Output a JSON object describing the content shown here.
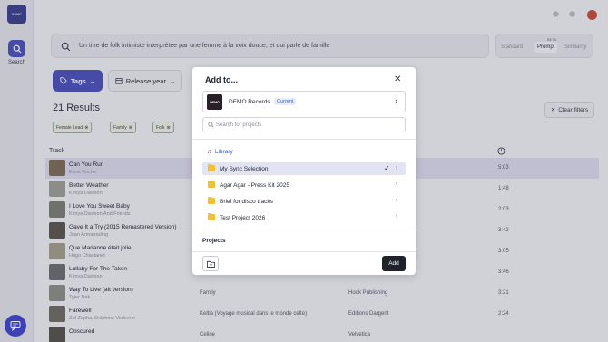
{
  "app": {
    "logo_text": "SYNC",
    "nav_search_label": "Search"
  },
  "search": {
    "query": "Un titre de folk intimiste interprétée par une femme à la voix douce, et qui parle de famille"
  },
  "modes": {
    "standard": "Standard",
    "prompt": "Prompt",
    "beta": "BETA",
    "similarity": "Similarity"
  },
  "filters": {
    "tags_label": "Tags",
    "release_label": "Release year",
    "results": "21 Results",
    "clear_label": "Clear filters",
    "chips": [
      "Female Lead",
      "Family",
      "Folk"
    ]
  },
  "table": {
    "track_header": "Track",
    "rows": [
      {
        "title": "Can You Run",
        "artist": "Ernst Koche",
        "c3": "",
        "c4": "",
        "c5": "5:03"
      },
      {
        "title": "Better Weather",
        "artist": "Kimya Dawson",
        "c3": "",
        "c4": "",
        "c5": "1:48"
      },
      {
        "title": "I Love You Sweet Baby",
        "artist": "Kimya Dawson And Friends",
        "c3": "",
        "c4": "",
        "c5": "2:03"
      },
      {
        "title": "Gave It a Try (2015 Remastered Version)",
        "artist": "Joan Armatrading",
        "c3": "",
        "c4": "",
        "c5": "3:42"
      },
      {
        "title": "Que Marianne était jolie",
        "artist": "Hugo Chastanet",
        "c3": "",
        "c4": "",
        "c5": "3:05"
      },
      {
        "title": "Lullaby For The Taken",
        "artist": "Kimya Dawson",
        "c3": "Aussin Vagenda",
        "c4": "Velvetica",
        "c5": "3:46"
      },
      {
        "title": "Way To Live (alt version)",
        "artist": "Tyler Nak",
        "c3": "Family",
        "c4": "Hook Publishing",
        "c5": "3:21"
      },
      {
        "title": "Farewell",
        "artist": "Zaf Zapha, Delphine Verleene",
        "c3": "Keltia (Voyage musical dans le monde celte)",
        "c4": "Editions Dargent",
        "c5": "2:24"
      },
      {
        "title": "Obscured",
        "artist": "",
        "c3": "Celine",
        "c4": "Velvetica",
        "c5": ""
      }
    ]
  },
  "modal": {
    "title": "Add to...",
    "account_logo_text": "DEMO",
    "account_name": "DEMO Records",
    "account_badge": "Current",
    "search_placeholder": "Search for projects",
    "library_label": "Library",
    "items": [
      "My Sync Selection",
      "Agar Agar - Press Kit 2025",
      "Brief for disco tracks",
      "Test Project 2026"
    ],
    "projects_label": "Projects",
    "add_label": "Add"
  },
  "colors": {
    "accent": "#4a50b8",
    "folder": "#f2c132",
    "library": "#3a55c8"
  }
}
